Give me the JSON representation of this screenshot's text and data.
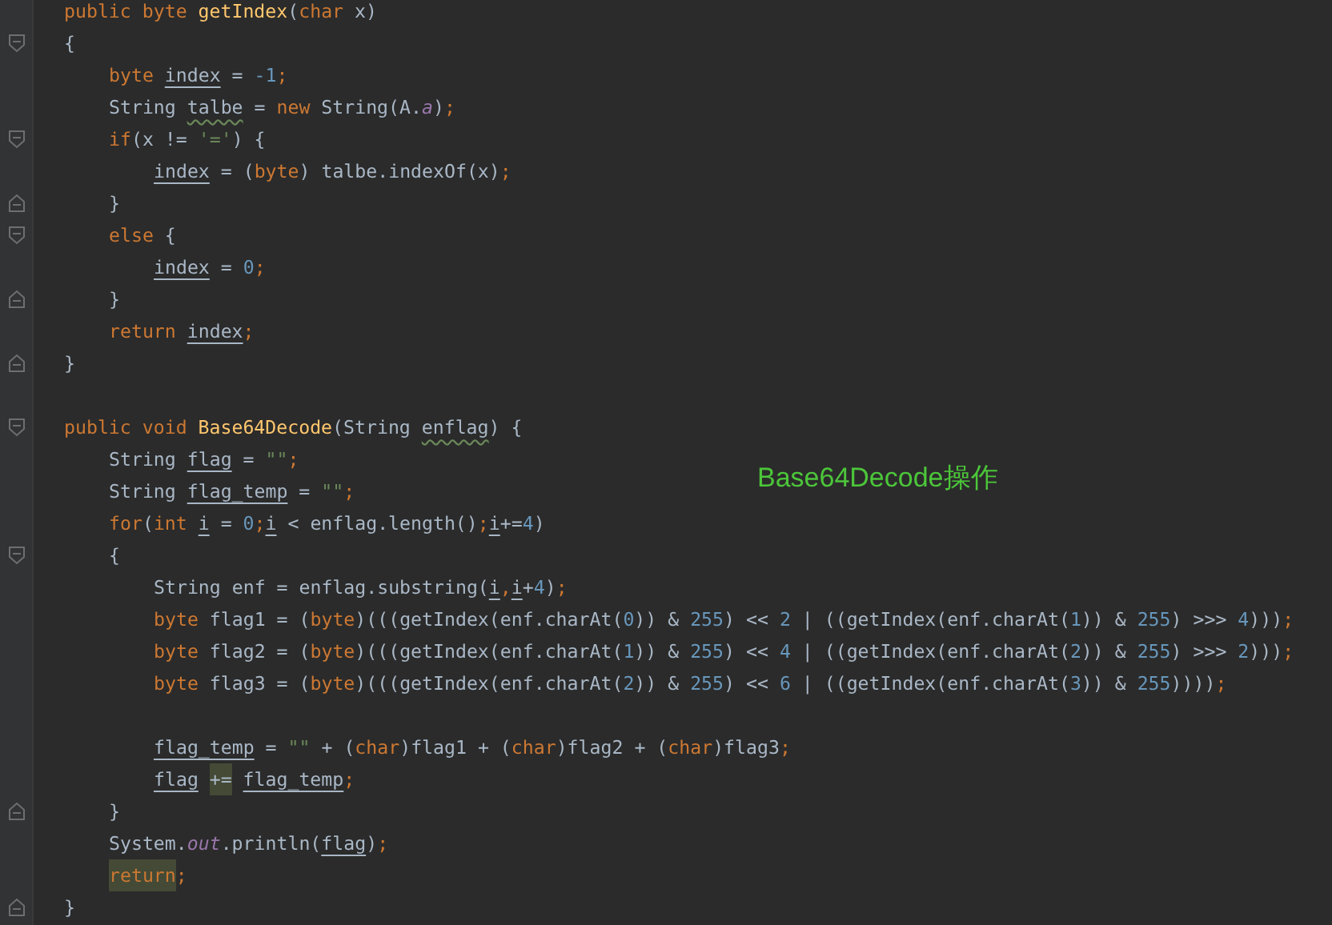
{
  "editor": {
    "lines": [
      {
        "kind": "code",
        "tokens": [
          {
            "kind": "kw",
            "text": "public "
          },
          {
            "kind": "kw",
            "text": "byte "
          },
          {
            "kind": "decl",
            "text": "getIndex"
          },
          {
            "kind": "plain",
            "text": "("
          },
          {
            "kind": "kw",
            "text": "char "
          },
          {
            "kind": "plain",
            "text": "x)"
          }
        ]
      },
      {
        "kind": "fold-start",
        "tokens": [
          {
            "kind": "plain",
            "text": "{"
          }
        ],
        "children": [
          {
            "kind": "code",
            "tokens": [
              {
                "kind": "kw",
                "text": "byte "
              },
              {
                "kind": "var",
                "text": "index"
              },
              {
                "kind": "plain",
                "text": " = "
              },
              {
                "kind": "num",
                "text": "-1"
              },
              {
                "kind": "kw",
                "text": ";"
              }
            ]
          },
          {
            "kind": "code",
            "tokens": [
              {
                "kind": "plain",
                "text": "String "
              },
              {
                "kind": "typo",
                "text": "talbe"
              },
              {
                "kind": "plain",
                "text": " = "
              },
              {
                "kind": "kw",
                "text": "new "
              },
              {
                "kind": "plain",
                "text": "String(A."
              },
              {
                "kind": "field",
                "text": "a"
              },
              {
                "kind": "plain",
                "text": ")"
              },
              {
                "kind": "kw",
                "text": ";"
              }
            ]
          },
          {
            "kind": "fold-start",
            "tokens": [
              {
                "kind": "kw",
                "text": "if"
              },
              {
                "kind": "plain",
                "text": "(x != "
              },
              {
                "kind": "str",
                "text": "'='"
              },
              {
                "kind": "plain",
                "text": ") {"
              }
            ],
            "children": [
              {
                "kind": "code",
                "tokens": [
                  {
                    "kind": "var",
                    "text": "index"
                  },
                  {
                    "kind": "plain",
                    "text": " = ("
                  },
                  {
                    "kind": "kw",
                    "text": "byte"
                  },
                  {
                    "kind": "plain",
                    "text": ") talbe.indexOf(x)"
                  },
                  {
                    "kind": "kw",
                    "text": ";"
                  }
                ]
              }
            ]
          },
          {
            "kind": "fold-end",
            "tokens": [
              {
                "kind": "plain",
                "text": "}"
              }
            ]
          },
          {
            "kind": "fold-start",
            "tokens": [
              {
                "kind": "kw",
                "text": "else "
              },
              {
                "kind": "plain",
                "text": "{"
              }
            ],
            "children": [
              {
                "kind": "code",
                "tokens": [
                  {
                    "kind": "var",
                    "text": "index"
                  },
                  {
                    "kind": "plain",
                    "text": " = "
                  },
                  {
                    "kind": "num",
                    "text": "0"
                  },
                  {
                    "kind": "kw",
                    "text": ";"
                  }
                ]
              }
            ]
          },
          {
            "kind": "fold-end",
            "tokens": [
              {
                "kind": "plain",
                "text": "}"
              }
            ]
          },
          {
            "kind": "code",
            "tokens": [
              {
                "kind": "kw",
                "text": "return "
              },
              {
                "kind": "var",
                "text": "index"
              },
              {
                "kind": "kw",
                "text": ";"
              }
            ]
          }
        ]
      },
      {
        "kind": "fold-end",
        "tokens": [
          {
            "kind": "plain",
            "text": "}"
          }
        ]
      },
      {
        "kind": "blank"
      },
      {
        "kind": "fold-start",
        "tokens": [
          {
            "kind": "kw",
            "text": "public "
          },
          {
            "kind": "kw",
            "text": "void "
          },
          {
            "kind": "decl",
            "text": "Base64Decode"
          },
          {
            "kind": "plain",
            "text": "(String "
          },
          {
            "kind": "typo",
            "text": "enflag"
          },
          {
            "kind": "plain",
            "text": ") {"
          }
        ],
        "children": [
          {
            "kind": "code",
            "tokens": [
              {
                "kind": "plain",
                "text": "String "
              },
              {
                "kind": "var",
                "text": "flag"
              },
              {
                "kind": "plain",
                "text": " = "
              },
              {
                "kind": "str",
                "text": "\"\""
              },
              {
                "kind": "kw",
                "text": ";"
              }
            ]
          },
          {
            "kind": "code",
            "tokens": [
              {
                "kind": "plain",
                "text": "String "
              },
              {
                "kind": "var",
                "text": "flag_temp"
              },
              {
                "kind": "plain",
                "text": " = "
              },
              {
                "kind": "str",
                "text": "\"\""
              },
              {
                "kind": "kw",
                "text": ";"
              }
            ]
          },
          {
            "kind": "code",
            "tokens": [
              {
                "kind": "kw",
                "text": "for"
              },
              {
                "kind": "plain",
                "text": "("
              },
              {
                "kind": "kw",
                "text": "int "
              },
              {
                "kind": "var",
                "text": "i"
              },
              {
                "kind": "plain",
                "text": " = "
              },
              {
                "kind": "num",
                "text": "0"
              },
              {
                "kind": "kw",
                "text": ";"
              },
              {
                "kind": "var",
                "text": "i"
              },
              {
                "kind": "plain",
                "text": " < enflag.length()"
              },
              {
                "kind": "kw",
                "text": ";"
              },
              {
                "kind": "var",
                "text": "i"
              },
              {
                "kind": "plain",
                "text": "+="
              },
              {
                "kind": "num",
                "text": "4"
              },
              {
                "kind": "plain",
                "text": ")"
              }
            ]
          },
          {
            "kind": "fold-start",
            "tokens": [
              {
                "kind": "plain",
                "text": "{"
              }
            ],
            "children": [
              {
                "kind": "code",
                "tokens": [
                  {
                    "kind": "plain",
                    "text": "String enf = enflag.substring("
                  },
                  {
                    "kind": "var",
                    "text": "i"
                  },
                  {
                    "kind": "kw",
                    "text": ","
                  },
                  {
                    "kind": "var",
                    "text": "i"
                  },
                  {
                    "kind": "plain",
                    "text": "+"
                  },
                  {
                    "kind": "num",
                    "text": "4"
                  },
                  {
                    "kind": "plain",
                    "text": ")"
                  },
                  {
                    "kind": "kw",
                    "text": ";"
                  }
                ]
              },
              {
                "kind": "code",
                "tokens": [
                  {
                    "kind": "kw",
                    "text": "byte "
                  },
                  {
                    "kind": "plain",
                    "text": "flag1 = ("
                  },
                  {
                    "kind": "kw",
                    "text": "byte"
                  },
                  {
                    "kind": "plain",
                    "text": ")(((getIndex(enf.charAt("
                  },
                  {
                    "kind": "num",
                    "text": "0"
                  },
                  {
                    "kind": "plain",
                    "text": ")) & "
                  },
                  {
                    "kind": "num",
                    "text": "255"
                  },
                  {
                    "kind": "plain",
                    "text": ") << "
                  },
                  {
                    "kind": "num",
                    "text": "2"
                  },
                  {
                    "kind": "plain",
                    "text": " | ((getIndex(enf.charAt("
                  },
                  {
                    "kind": "num",
                    "text": "1"
                  },
                  {
                    "kind": "plain",
                    "text": ")) & "
                  },
                  {
                    "kind": "num",
                    "text": "255"
                  },
                  {
                    "kind": "plain",
                    "text": ") >>> "
                  },
                  {
                    "kind": "num",
                    "text": "4"
                  },
                  {
                    "kind": "plain",
                    "text": ")))"
                  },
                  {
                    "kind": "kw",
                    "text": ";"
                  }
                ]
              },
              {
                "kind": "code",
                "tokens": [
                  {
                    "kind": "kw",
                    "text": "byte "
                  },
                  {
                    "kind": "plain",
                    "text": "flag2 = ("
                  },
                  {
                    "kind": "kw",
                    "text": "byte"
                  },
                  {
                    "kind": "plain",
                    "text": ")(((getIndex(enf.charAt("
                  },
                  {
                    "kind": "num",
                    "text": "1"
                  },
                  {
                    "kind": "plain",
                    "text": ")) & "
                  },
                  {
                    "kind": "num",
                    "text": "255"
                  },
                  {
                    "kind": "plain",
                    "text": ") << "
                  },
                  {
                    "kind": "num",
                    "text": "4"
                  },
                  {
                    "kind": "plain",
                    "text": " | ((getIndex(enf.charAt("
                  },
                  {
                    "kind": "num",
                    "text": "2"
                  },
                  {
                    "kind": "plain",
                    "text": ")) & "
                  },
                  {
                    "kind": "num",
                    "text": "255"
                  },
                  {
                    "kind": "plain",
                    "text": ") >>> "
                  },
                  {
                    "kind": "num",
                    "text": "2"
                  },
                  {
                    "kind": "plain",
                    "text": ")))"
                  },
                  {
                    "kind": "kw",
                    "text": ";"
                  }
                ]
              },
              {
                "kind": "code",
                "tokens": [
                  {
                    "kind": "kw",
                    "text": "byte "
                  },
                  {
                    "kind": "plain",
                    "text": "flag3 = ("
                  },
                  {
                    "kind": "kw",
                    "text": "byte"
                  },
                  {
                    "kind": "plain",
                    "text": ")(((getIndex(enf.charAt("
                  },
                  {
                    "kind": "num",
                    "text": "2"
                  },
                  {
                    "kind": "plain",
                    "text": ")) & "
                  },
                  {
                    "kind": "num",
                    "text": "255"
                  },
                  {
                    "kind": "plain",
                    "text": ") << "
                  },
                  {
                    "kind": "num",
                    "text": "6"
                  },
                  {
                    "kind": "plain",
                    "text": " | ((getIndex(enf.charAt("
                  },
                  {
                    "kind": "num",
                    "text": "3"
                  },
                  {
                    "kind": "plain",
                    "text": ")) & "
                  },
                  {
                    "kind": "num",
                    "text": "255"
                  },
                  {
                    "kind": "plain",
                    "text": "))))"
                  },
                  {
                    "kind": "kw",
                    "text": ";"
                  }
                ]
              },
              {
                "kind": "blank"
              },
              {
                "kind": "code",
                "tokens": [
                  {
                    "kind": "var",
                    "text": "flag_temp"
                  },
                  {
                    "kind": "plain",
                    "text": " = "
                  },
                  {
                    "kind": "str",
                    "text": "\"\""
                  },
                  {
                    "kind": "plain",
                    "text": " + ("
                  },
                  {
                    "kind": "kw",
                    "text": "char"
                  },
                  {
                    "kind": "plain",
                    "text": ")flag1 + ("
                  },
                  {
                    "kind": "kw",
                    "text": "char"
                  },
                  {
                    "kind": "plain",
                    "text": ")flag2 + ("
                  },
                  {
                    "kind": "kw",
                    "text": "char"
                  },
                  {
                    "kind": "plain",
                    "text": ")flag3"
                  },
                  {
                    "kind": "kw",
                    "text": ";"
                  }
                ]
              },
              {
                "kind": "code",
                "tokens": [
                  {
                    "kind": "var",
                    "text": "flag"
                  },
                  {
                    "kind": "match",
                    "text": "+="
                  },
                  {
                    "kind": "var",
                    "text": "flag_temp"
                  },
                  {
                    "kind": "kw",
                    "text": ";"
                  }
                ]
              }
            ]
          },
          {
            "kind": "fold-end",
            "tokens": [
              {
                "kind": "plain",
                "text": "}"
              }
            ]
          },
          {
            "kind": "code",
            "tokens": [
              {
                "kind": "plain",
                "text": "System."
              },
              {
                "kind": "field",
                "text": "out"
              },
              {
                "kind": "plain",
                "text": ".println("
              },
              {
                "kind": "var",
                "text": "flag"
              },
              {
                "kind": "plain",
                "text": ")"
              },
              {
                "kind": "kw",
                "text": ";"
              }
            ]
          },
          {
            "kind": "code",
            "tokens": [
              {
                "kind": "kwmatch",
                "text": "return"
              },
              {
                "kind": "kw",
                "text": ";"
              }
            ]
          }
        ]
      },
      {
        "kind": "fold-end",
        "tokens": [
          {
            "kind": "plain",
            "text": "}"
          }
        ]
      }
    ]
  },
  "annotation": "Base64Decode操作"
}
